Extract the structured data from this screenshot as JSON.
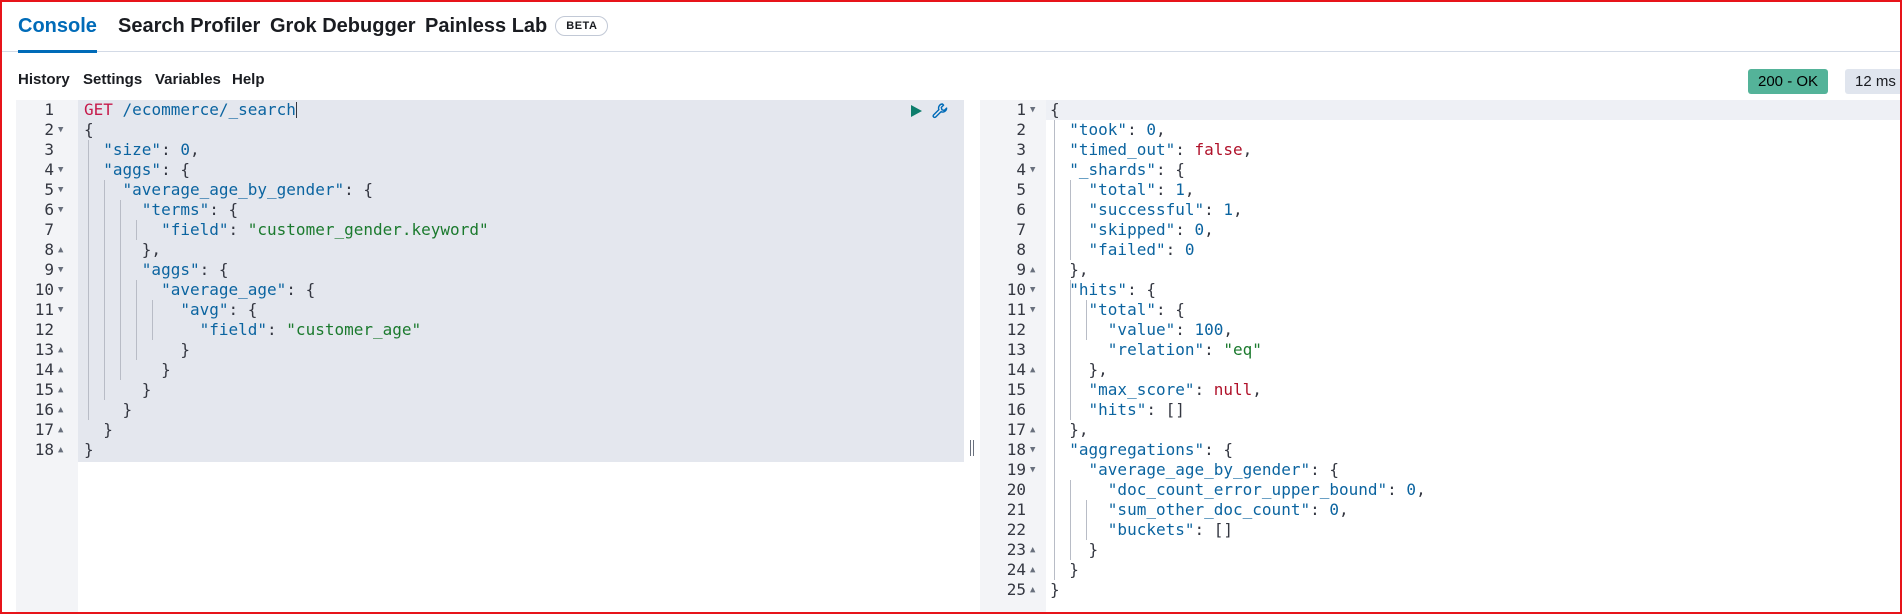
{
  "tabs": [
    {
      "label": "Console",
      "active": true
    },
    {
      "label": "Search Profiler",
      "active": false
    },
    {
      "label": "Grok Debugger",
      "active": false
    },
    {
      "label": "Painless Lab",
      "active": false,
      "badge": "BETA"
    }
  ],
  "menu": [
    "History",
    "Settings",
    "Variables",
    "Help"
  ],
  "status": {
    "code": "200 - OK",
    "time": "12 ms",
    "colors": {
      "ok": "#54b399",
      "time": "#e0e5ee"
    }
  },
  "request": {
    "method": "GET",
    "path": "/ecommerce/_search",
    "lines": [
      "GET /ecommerce/_search",
      "{",
      "  \"size\": 0,",
      "  \"aggs\": {",
      "    \"average_age_by_gender\": {",
      "      \"terms\": {",
      "        \"field\": \"customer_gender.keyword\"",
      "      },",
      "      \"aggs\": {",
      "        \"average_age\": {",
      "          \"avg\": {",
      "            \"field\": \"customer_age\"",
      "          }",
      "        }",
      "      }",
      "    }",
      "  }",
      "}"
    ]
  },
  "response": {
    "lines": [
      "{",
      "  \"took\": 0,",
      "  \"timed_out\": false,",
      "  \"_shards\": {",
      "    \"total\": 1,",
      "    \"successful\": 1,",
      "    \"skipped\": 0,",
      "    \"failed\": 0",
      "  },",
      "  \"hits\": {",
      "    \"total\": {",
      "      \"value\": 100,",
      "      \"relation\": \"eq\"",
      "    },",
      "    \"max_score\": null,",
      "    \"hits\": []",
      "  },",
      "  \"aggregations\": {",
      "    \"average_age_by_gender\": {",
      "      \"doc_count_error_upper_bound\": 0,",
      "      \"sum_other_doc_count\": 0,",
      "      \"buckets\": []",
      "    }",
      "  }",
      "}"
    ]
  }
}
